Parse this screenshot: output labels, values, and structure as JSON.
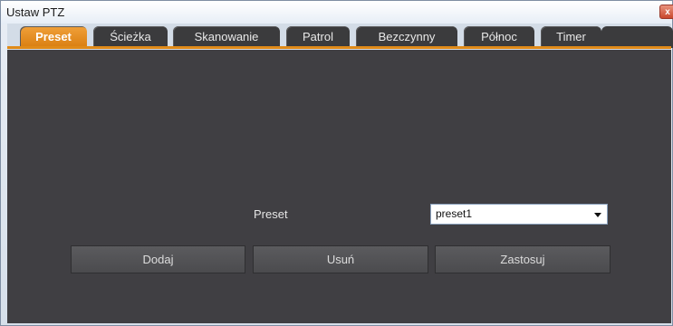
{
  "window": {
    "title": "Ustaw PTZ",
    "close_glyph": "x"
  },
  "tabs": [
    {
      "label": "Preset",
      "active": true
    },
    {
      "label": "Ścieżka",
      "active": false
    },
    {
      "label": "Skanowanie",
      "active": false
    },
    {
      "label": "Patrol",
      "active": false
    },
    {
      "label": "Bezczynny",
      "active": false
    },
    {
      "label": "Północ",
      "active": false
    },
    {
      "label": "Timer",
      "active": false
    }
  ],
  "preset": {
    "label": "Preset",
    "selected": "preset1"
  },
  "buttons": {
    "add": "Dodaj",
    "delete": "Usuń",
    "apply": "Zastosuj"
  },
  "colors": {
    "accent": "#e08a18",
    "panel": "#403f43"
  }
}
